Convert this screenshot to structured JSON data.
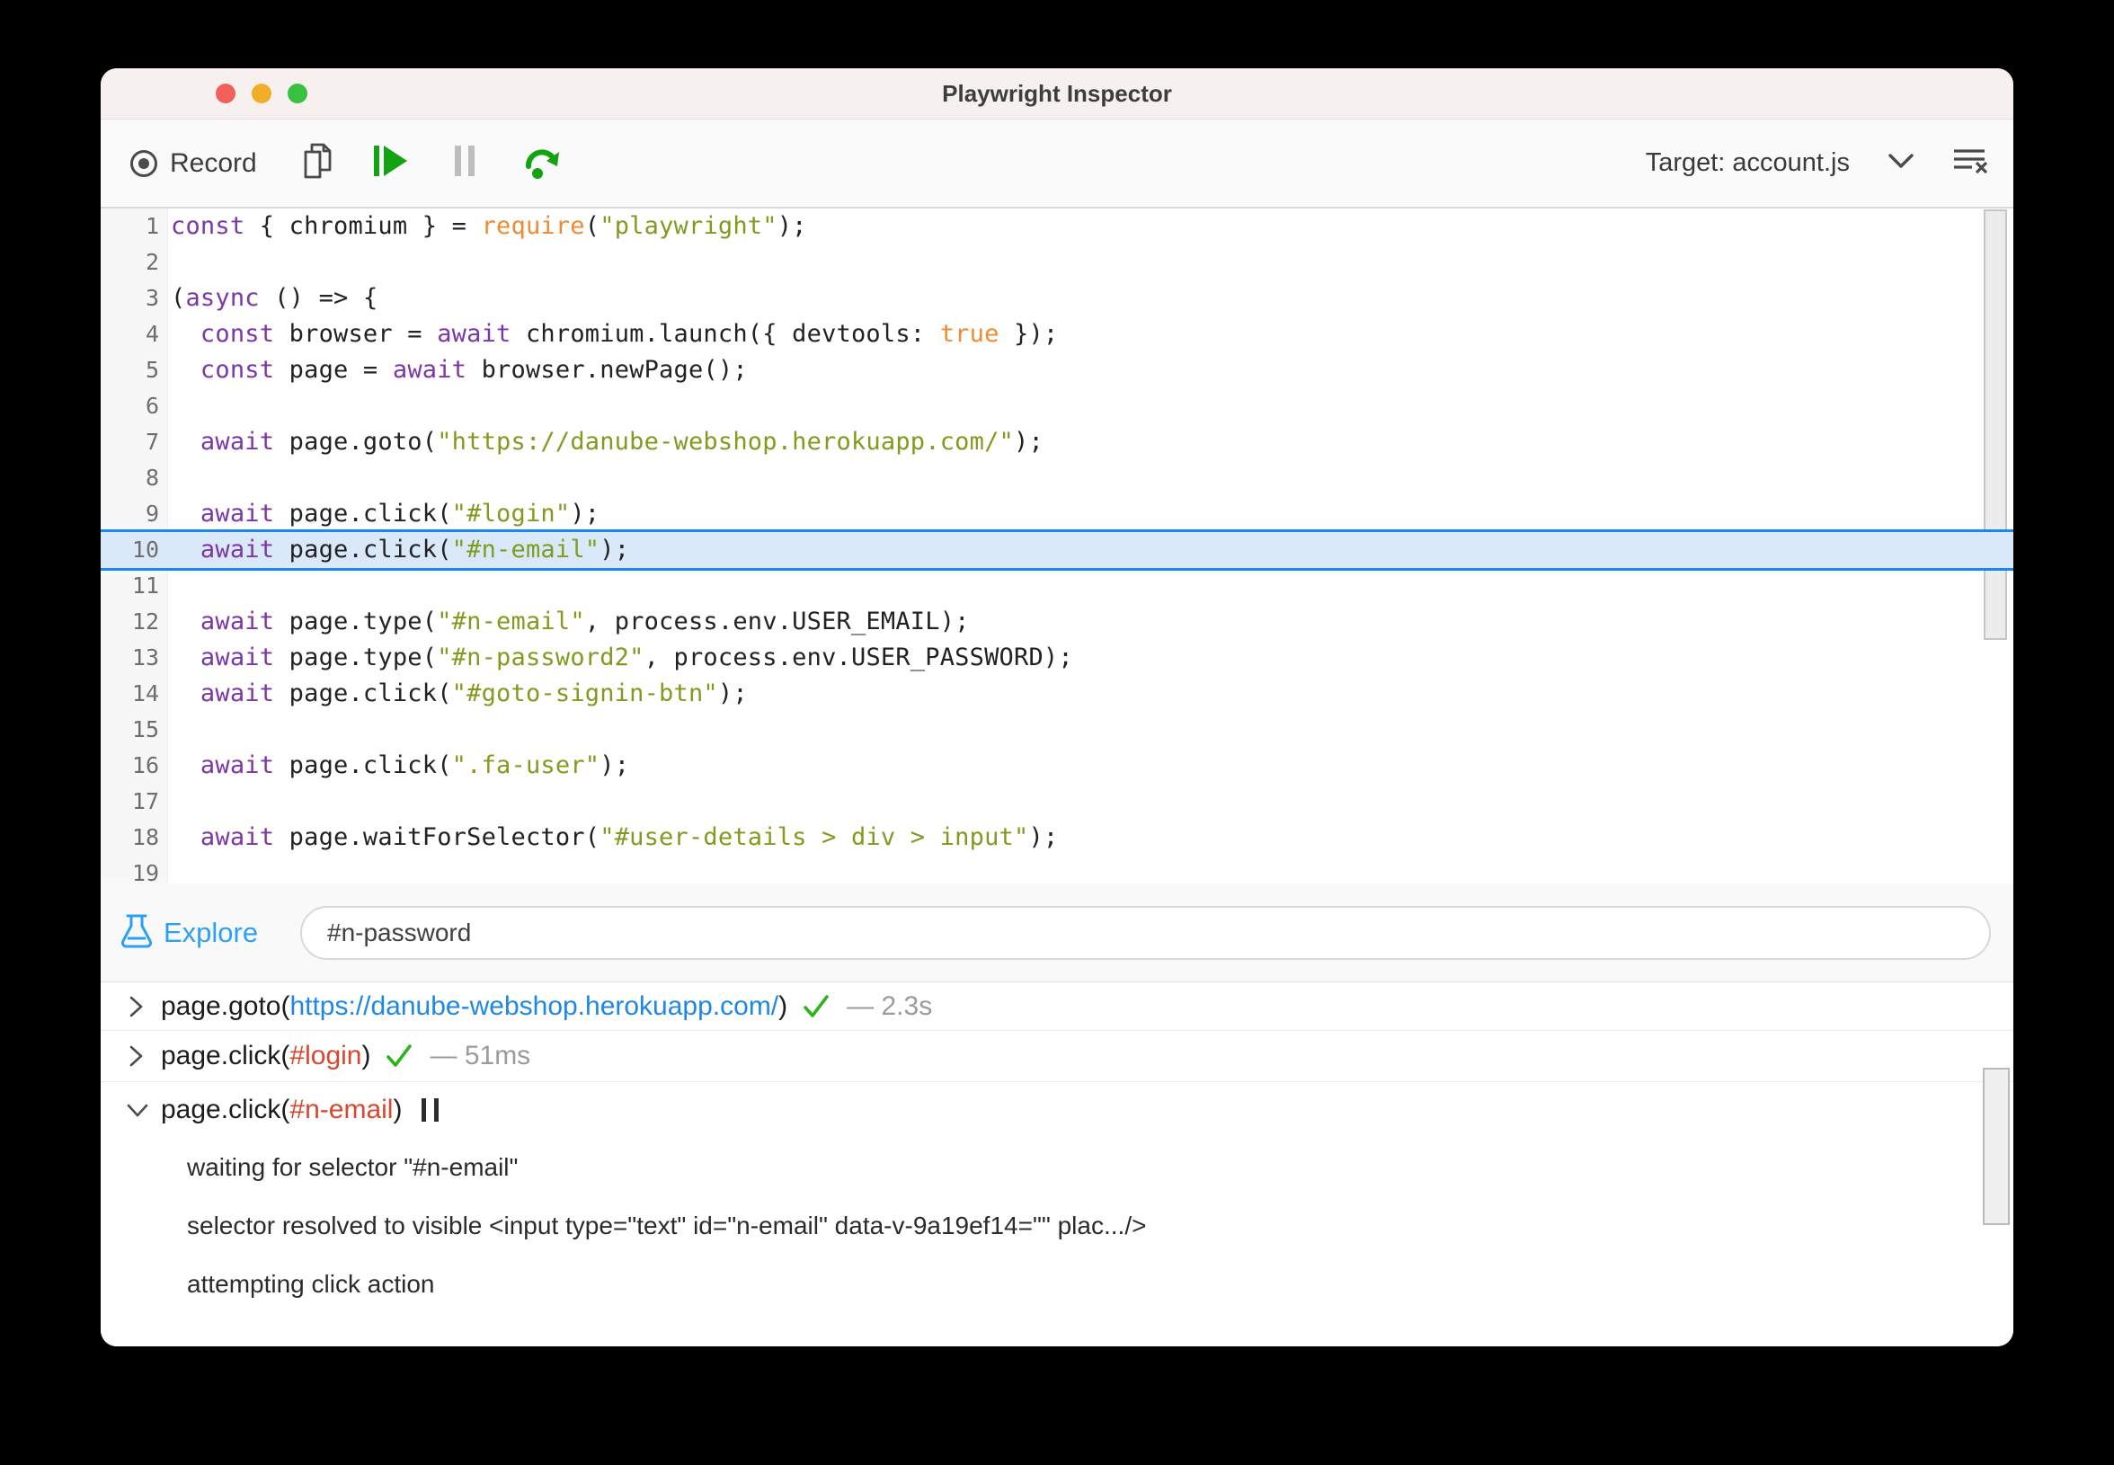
{
  "window": {
    "title": "Playwright Inspector"
  },
  "toolbar": {
    "record_label": "Record",
    "target_label": "Target:",
    "target_value": "account.js",
    "icons": [
      "record-icon",
      "copy-icon",
      "resume-icon",
      "pause-icon",
      "step-over-icon",
      "chevron-down-icon",
      "clear-log-icon"
    ]
  },
  "editor": {
    "highlighted_line": 10,
    "lines": [
      [
        [
          "kw",
          "const"
        ],
        [
          "p",
          " { chromium } = "
        ],
        [
          "fn",
          "require"
        ],
        [
          "p",
          "("
        ],
        [
          "str",
          "\"playwright\""
        ],
        [
          "p",
          ");"
        ]
      ],
      [],
      [
        [
          "p",
          "("
        ],
        [
          "kw",
          "async"
        ],
        [
          "p",
          " () => {"
        ]
      ],
      [
        [
          "p",
          "  "
        ],
        [
          "kw",
          "const"
        ],
        [
          "p",
          " browser = "
        ],
        [
          "kw",
          "await"
        ],
        [
          "p",
          " chromium.launch({ devtools: "
        ],
        [
          "atom",
          "true"
        ],
        [
          "p",
          " });"
        ]
      ],
      [
        [
          "p",
          "  "
        ],
        [
          "kw",
          "const"
        ],
        [
          "p",
          " page = "
        ],
        [
          "kw",
          "await"
        ],
        [
          "p",
          " browser.newPage();"
        ]
      ],
      [],
      [
        [
          "p",
          "  "
        ],
        [
          "kw",
          "await"
        ],
        [
          "p",
          " page.goto("
        ],
        [
          "str",
          "\"https://danube-webshop.herokuapp.com/\""
        ],
        [
          "p",
          ");"
        ]
      ],
      [],
      [
        [
          "p",
          "  "
        ],
        [
          "kw",
          "await"
        ],
        [
          "p",
          " page.click("
        ],
        [
          "str",
          "\"#login\""
        ],
        [
          "p",
          ");"
        ]
      ],
      [
        [
          "p",
          "  "
        ],
        [
          "kw",
          "await"
        ],
        [
          "p",
          " page.click("
        ],
        [
          "str",
          "\"#n-email\""
        ],
        [
          "p",
          ");"
        ]
      ],
      [],
      [
        [
          "p",
          "  "
        ],
        [
          "kw",
          "await"
        ],
        [
          "p",
          " page.type("
        ],
        [
          "str",
          "\"#n-email\""
        ],
        [
          "p",
          ", process.env.USER_EMAIL);"
        ]
      ],
      [
        [
          "p",
          "  "
        ],
        [
          "kw",
          "await"
        ],
        [
          "p",
          " page.type("
        ],
        [
          "str",
          "\"#n-password2\""
        ],
        [
          "p",
          ", process.env.USER_PASSWORD);"
        ]
      ],
      [
        [
          "p",
          "  "
        ],
        [
          "kw",
          "await"
        ],
        [
          "p",
          " page.click("
        ],
        [
          "str",
          "\"#goto-signin-btn\""
        ],
        [
          "p",
          ");"
        ]
      ],
      [],
      [
        [
          "p",
          "  "
        ],
        [
          "kw",
          "await"
        ],
        [
          "p",
          " page.click("
        ],
        [
          "str",
          "\".fa-user\""
        ],
        [
          "p",
          ");"
        ]
      ],
      [],
      [
        [
          "p",
          "  "
        ],
        [
          "kw",
          "await"
        ],
        [
          "p",
          " page.waitForSelector("
        ],
        [
          "str",
          "\"#user-details > div > input\""
        ],
        [
          "p",
          ");"
        ]
      ],
      []
    ]
  },
  "explore": {
    "label": "Explore",
    "input_value": "#n-password"
  },
  "log": {
    "entries": [
      {
        "expanded": false,
        "method": "page.goto(",
        "arg": "https://danube-webshop.herokuapp.com/",
        "arg_type": "link",
        "close": ")",
        "status": "success",
        "duration": "— 2.3s"
      },
      {
        "expanded": false,
        "method": "page.click(",
        "arg": "#login",
        "arg_type": "selector",
        "close": ")",
        "status": "success",
        "duration": "— 51ms"
      },
      {
        "expanded": true,
        "method": "page.click(",
        "arg": "#n-email",
        "arg_type": "selector",
        "close": ")",
        "status": "paused",
        "details": [
          "waiting for selector \"#n-email\"",
          "selector resolved to visible <input type=\"text\" id=\"n-email\" data-v-9a19ef14=\"\" plac.../>",
          "attempting click action"
        ]
      }
    ]
  },
  "colors": {
    "keyword": "#7d36a8",
    "string": "#7f9c1f",
    "function": "#f08a33",
    "highlight_fill": "#d9e9fa",
    "highlight_border": "#1e87ec",
    "link": "#1f87e5",
    "selector": "#d9472e",
    "success_green": "#2fb31d",
    "toolbar_green": "#12a312",
    "explore_blue": "#2d9ff5",
    "titlebar_bg": "#f6f0ef",
    "traffic_red": "#f1615a",
    "traffic_yellow": "#f2ae29",
    "traffic_green": "#38c03f"
  }
}
